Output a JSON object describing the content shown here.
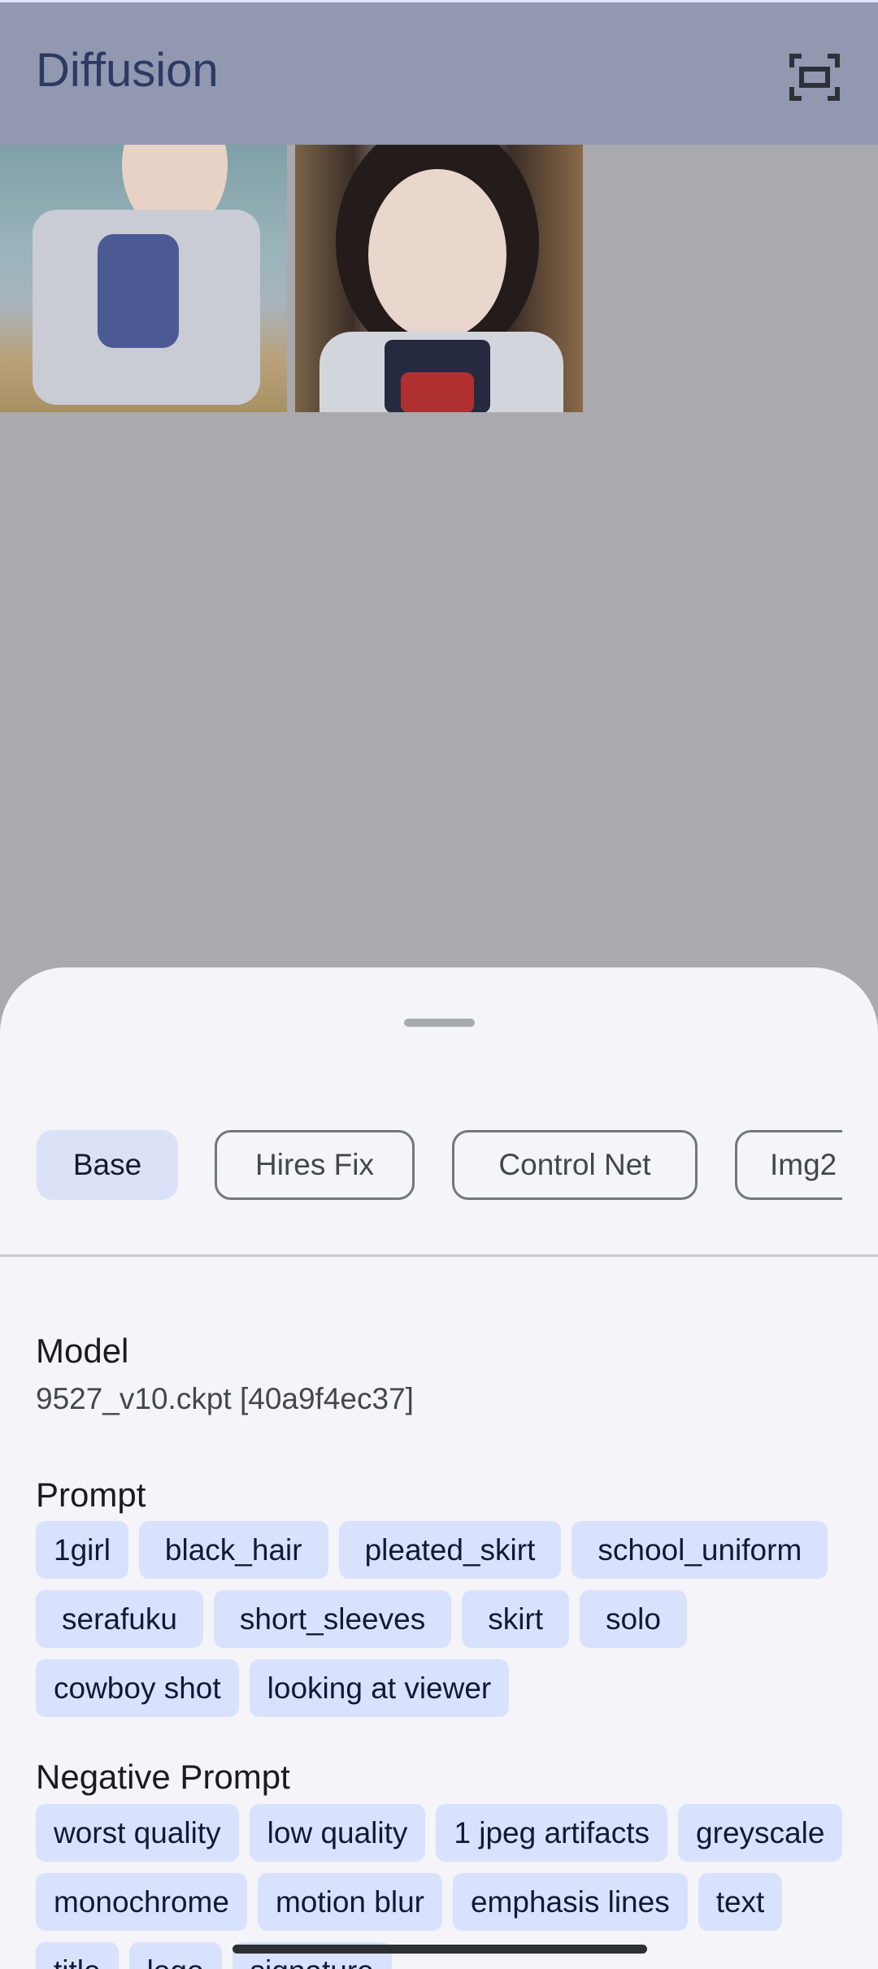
{
  "app": {
    "title": "Diffusion",
    "fullscreen_icon": "fullscreen-icon"
  },
  "gallery": {
    "images": [
      "generated-image-1",
      "generated-image-2"
    ]
  },
  "sheet": {
    "tabs": [
      {
        "label": "Base",
        "active": true
      },
      {
        "label": "Hires Fix",
        "active": false
      },
      {
        "label": "Control Net",
        "active": false
      },
      {
        "label": "Img2",
        "active": false
      }
    ],
    "model": {
      "label": "Model",
      "value": "9527_v10.ckpt [40a9f4ec37]"
    },
    "prompt": {
      "label": "Prompt",
      "tags": [
        "1girl",
        "black_hair",
        "pleated_skirt",
        "school_uniform",
        "serafuku",
        "short_sleeves",
        "skirt",
        "solo",
        "cowboy shot",
        "looking at viewer"
      ]
    },
    "negative_prompt": {
      "label": "Negative Prompt",
      "tags": [
        "worst quality",
        "low quality",
        "1 jpeg artifacts",
        "greyscale",
        "monochrome",
        "motion blur",
        "emphasis lines",
        "text",
        "title",
        "logo",
        "signature"
      ]
    }
  },
  "colors": {
    "chip_bg": "#d8e2fc",
    "header_bg": "#9198b0",
    "sheet_bg": "#f4f4f9"
  }
}
